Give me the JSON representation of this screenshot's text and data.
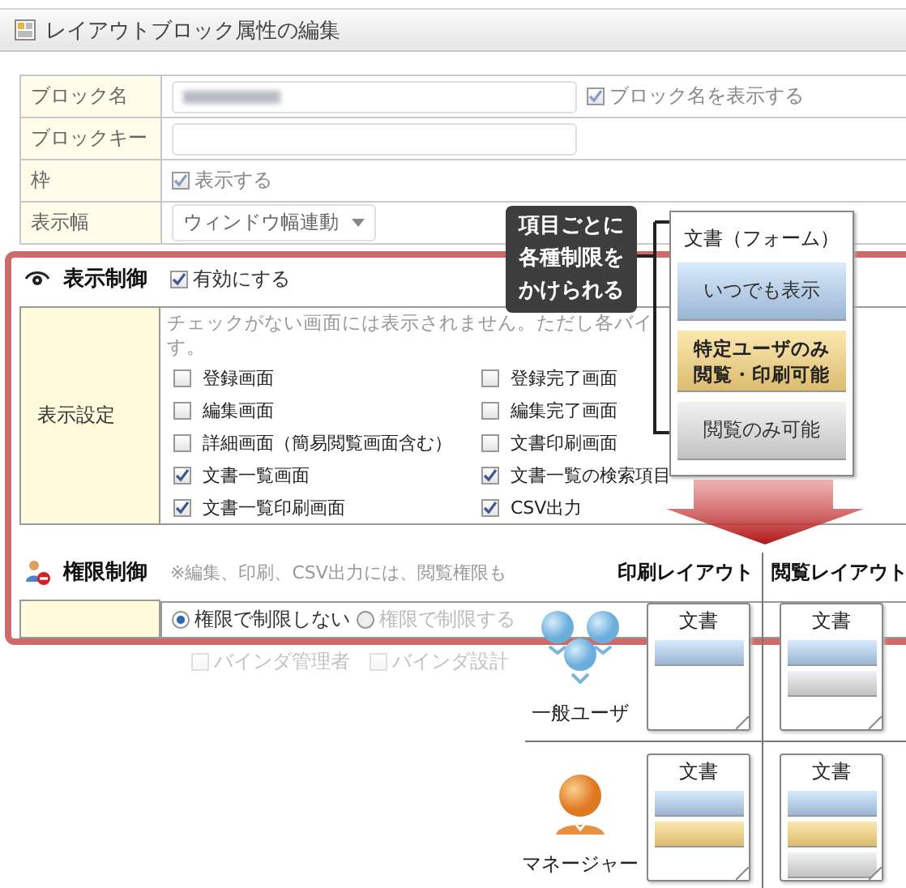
{
  "window": {
    "title": "レイアウトブロック属性の編集"
  },
  "form": {
    "rows": [
      {
        "kind": "redacted_field",
        "label": "ブロック名",
        "check": {
          "label": "ブロック名を表示する",
          "checked": true
        }
      },
      {
        "kind": "field",
        "label": "ブロックキー"
      },
      {
        "kind": "checkbox",
        "label": "枠",
        "check": {
          "label": "表示する",
          "checked": true
        }
      },
      {
        "kind": "select",
        "label": "表示幅",
        "value": "ウィンドウ幅連動"
      }
    ]
  },
  "display_control": {
    "title": "表示制御",
    "enable": {
      "label": "有効にする",
      "checked": true
    },
    "setting_label": "表示設定",
    "description": [
      "チェックがない画面には表示されません。ただし各バイ",
      "す。"
    ],
    "options": [
      {
        "label": "登録画面",
        "checked": false
      },
      {
        "label": "登録完了画面",
        "checked": false
      },
      {
        "label": "編集画面",
        "checked": false
      },
      {
        "label": "編集完了画面",
        "checked": false
      },
      {
        "label": "詳細画面（簡易閲覧画面含む）",
        "checked": false
      },
      {
        "label": "文書印刷画面",
        "checked": false
      },
      {
        "label": "文書一覧画面",
        "checked": true
      },
      {
        "label": "文書一覧の検索項目",
        "checked": true
      },
      {
        "label": "文書一覧印刷画面",
        "checked": true
      },
      {
        "label": "CSV出力",
        "checked": true
      }
    ]
  },
  "permission_control": {
    "title": "権限制御",
    "note": "※編集、印刷、CSV出力には、閲覧権限も",
    "radios": [
      {
        "label": "権限で制限しない",
        "selected": true
      },
      {
        "label": "権限で制限する",
        "selected": false
      }
    ],
    "roles": [
      {
        "label": "バインダ管理者",
        "checked": false
      },
      {
        "label": "バインダ設計",
        "checked": false
      }
    ]
  },
  "callout": {
    "lines": [
      "項目ごとに",
      "各種制限を",
      "かけられる"
    ]
  },
  "legend": {
    "title": "文書（フォーム）",
    "items": [
      {
        "kind": "always",
        "label": "いつでも表示"
      },
      {
        "kind": "restricted",
        "label": "特定ユーザのみ閲覧・印刷可能"
      },
      {
        "kind": "readonly",
        "label": "閲覧のみ可能"
      }
    ]
  },
  "matrix": {
    "columns": [
      "印刷レイアウト",
      "閲覧レイアウト"
    ],
    "rows": [
      {
        "user": "一般ユーザ",
        "kind": "group",
        "docs": [
          {
            "title": "文書",
            "blocks": [
              {
                "kind": "always"
              }
            ]
          },
          {
            "title": "文書",
            "blocks": [
              {
                "kind": "always"
              },
              {
                "kind": "readonly"
              }
            ]
          }
        ]
      },
      {
        "user": "マネージャー",
        "kind": "manager",
        "docs": [
          {
            "title": "文書",
            "blocks": [
              {
                "kind": "always"
              },
              {
                "kind": "restricted"
              }
            ]
          },
          {
            "title": "文書",
            "blocks": [
              {
                "kind": "always"
              },
              {
                "kind": "restricted"
              },
              {
                "kind": "readonly"
              }
            ]
          }
        ]
      }
    ]
  }
}
